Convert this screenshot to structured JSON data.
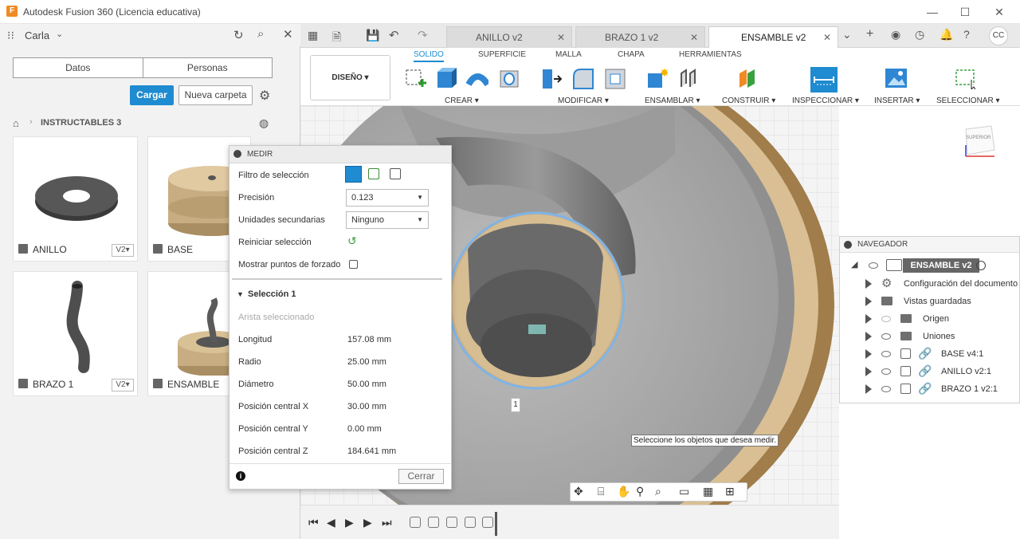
{
  "window": {
    "title": "Autodesk Fusion 360 (Licencia educativa)",
    "logo_letter": "F"
  },
  "data_panel": {
    "user": "Carla",
    "tabs": [
      "Datos",
      "Personas"
    ],
    "upload_label": "Cargar",
    "new_folder_label": "Nueva carpeta",
    "breadcrumb": "INSTRUCTABLES 3",
    "items": [
      {
        "name": "ANILLO",
        "version": "V2▾"
      },
      {
        "name": "BASE",
        "version": ""
      },
      {
        "name": "BRAZO 1",
        "version": "V2▾"
      },
      {
        "name": "ENSAMBLE",
        "version": ""
      }
    ]
  },
  "doc_tabs": [
    {
      "label": "ANILLO v2",
      "active": false
    },
    {
      "label": "BRAZO 1 v2",
      "active": false
    },
    {
      "label": "ENSAMBLE v2",
      "active": true
    }
  ],
  "avatar_initials": "CC",
  "ribbon": {
    "workspace": "DISEÑO ▾",
    "tabs": [
      "SOLIDO",
      "SUPERFICIE",
      "MALLA",
      "CHAPA",
      "HERRAMIENTAS"
    ],
    "groups": [
      "CREAR ▾",
      "MODIFICAR ▾",
      "ENSAMBLAR ▾",
      "CONSTRUIR ▾",
      "INSPECCIONAR ▾",
      "INSERTAR ▾",
      "SELECCIONAR ▾"
    ]
  },
  "measure": {
    "title": "MEDIR",
    "labels": {
      "filter": "Filtro de selección",
      "precision": "Precisión",
      "secondary_units": "Unidades secundarias",
      "reset": "Reiniciar selección",
      "snap": "Mostrar puntos de forzado"
    },
    "precision_value": "0.123",
    "secondary_units_value": "Ninguno",
    "selection_title": "Selección 1",
    "selected_hint": "Arista seleccionado",
    "rows": [
      {
        "label": "Longitud",
        "value": "157.08 mm"
      },
      {
        "label": "Radio",
        "value": "25.00 mm"
      },
      {
        "label": "Diámetro",
        "value": "50.00 mm"
      },
      {
        "label": "Posición central X",
        "value": "30.00 mm"
      },
      {
        "label": "Posición central Y",
        "value": "0.00 mm"
      },
      {
        "label": "Posición central Z",
        "value": "184.641 mm"
      }
    ],
    "close_label": "Cerrar"
  },
  "viewport": {
    "tooltip": "Seleccione los objetos que desea medir.",
    "marker": "1",
    "viewcube_label": "SUPERIOR"
  },
  "navigator": {
    "title": "NAVEGADOR",
    "root": "ENSAMBLE v2",
    "items": [
      "Configuración del documento",
      "Vistas guardadas",
      "Origen",
      "Uniones",
      "BASE v4:1",
      "ANILLO v2:1",
      "BRAZO 1 v2:1"
    ]
  }
}
